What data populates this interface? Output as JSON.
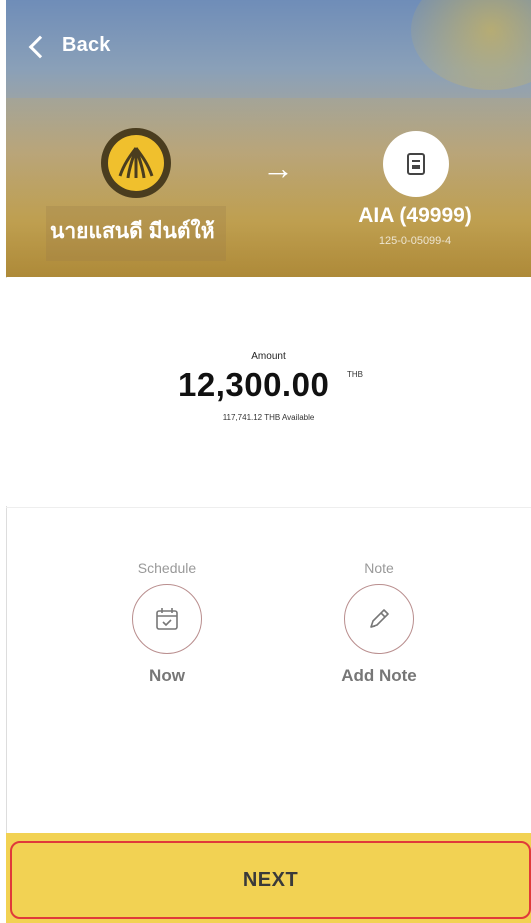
{
  "header": {
    "back_label": "Back",
    "from": {
      "name": "นายแสนดี มีนต์ให้"
    },
    "arrow": "→",
    "to": {
      "name": "AIA (49999)",
      "account": "125-0-05099-4"
    }
  },
  "amount": {
    "label": "Amount",
    "value": "12,300.00",
    "currency": "THB",
    "available": "117,741.12 THB Available"
  },
  "options": {
    "schedule": {
      "caption": "Schedule",
      "value": "Now"
    },
    "note": {
      "caption": "Note",
      "value": "Add Note"
    }
  },
  "footer": {
    "next_label": "NEXT"
  },
  "colors": {
    "accent_yellow": "#f2d253",
    "highlight_red": "#e03a3a",
    "bank_logo_gold": "#f0c02d",
    "icon_ring": "#b98e8e"
  }
}
